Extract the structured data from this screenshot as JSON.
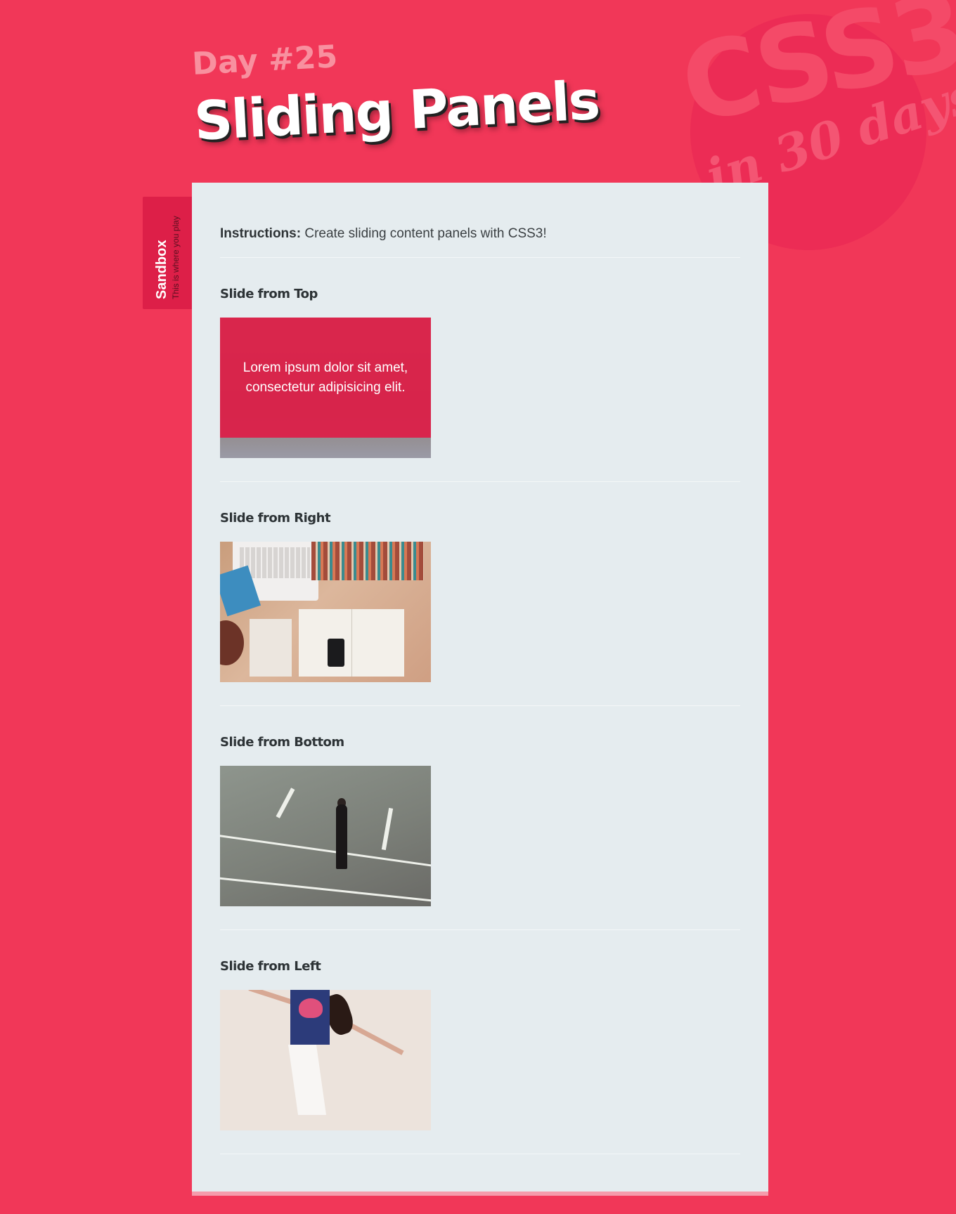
{
  "header": {
    "day_label": "Day #25",
    "title": "Sliding Panels"
  },
  "badge": {
    "css_text": "CSS3",
    "days_text": "in 30 days"
  },
  "sandbox_tab": {
    "title": "Sandbox",
    "subtitle": "This is where you play"
  },
  "instructions": {
    "label": "Instructions:",
    "text": "Create sliding content panels with CSS3!"
  },
  "sections": [
    {
      "heading": "Slide from Top",
      "overlay_text": "Lorem ipsum dolor sit amet, consectetur adipisicing elit."
    },
    {
      "heading": "Slide from Right"
    },
    {
      "heading": "Slide from Bottom"
    },
    {
      "heading": "Slide from Left"
    }
  ],
  "colors": {
    "page_background": "#f13758",
    "card_background": "#e5ecef",
    "overlay": "#dc1f48",
    "tab": "#dd1f48"
  }
}
